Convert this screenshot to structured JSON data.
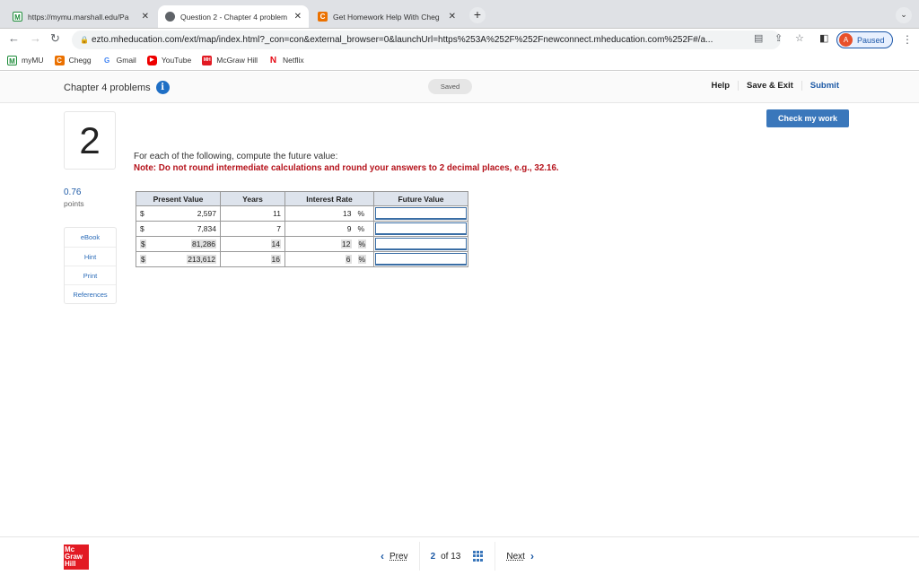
{
  "browser": {
    "tabs": [
      {
        "title": "https://mymu.marshall.edu/Pa",
        "icon": "marshall-m-icon",
        "active": false
      },
      {
        "title": "Question 2 - Chapter 4 problem",
        "icon": "globe-icon",
        "active": true
      },
      {
        "title": "Get Homework Help With Cheg",
        "icon": "chegg-c-icon",
        "active": false
      }
    ],
    "new_tab": "+",
    "tab_menu": "⌄",
    "url": "ezto.mheducation.com/ext/map/index.html?_con=con&external_browser=0&launchUrl=https%253A%252F%252Fnewconnect.mheducation.com%252F#/a...",
    "profile_initial": "A",
    "profile_status": "Paused",
    "bookmarks": [
      {
        "label": "myMU",
        "icon": "marshall-m-icon"
      },
      {
        "label": "Chegg",
        "icon": "chegg-c-icon"
      },
      {
        "label": "Gmail",
        "icon": "google-g-icon"
      },
      {
        "label": "YouTube",
        "icon": "youtube-icon"
      },
      {
        "label": "McGraw Hill",
        "icon": "mcgraw-hill-icon"
      },
      {
        "label": "Netflix",
        "icon": "netflix-icon"
      }
    ]
  },
  "header": {
    "title": "Chapter 4 problems",
    "saved": "Saved",
    "links": {
      "help": "Help",
      "save_exit": "Save & Exit",
      "submit": "Submit"
    }
  },
  "question": {
    "number": "2",
    "points_value": "0.76",
    "points_label": "points",
    "check_button": "Check my work",
    "prompt": "For each of the following, compute the future value:",
    "note": "Note: Do not round intermediate calculations and round your answers to 2 decimal places, e.g., 32.16.",
    "resources": [
      "eBook",
      "Hint",
      "Print",
      "References"
    ]
  },
  "table": {
    "headers": [
      "Present Value",
      "Years",
      "Interest Rate",
      "Future Value"
    ],
    "currency": "$",
    "percent": "%",
    "rows": [
      {
        "pv": "2,597",
        "years": "11",
        "rate": "13",
        "fv": ""
      },
      {
        "pv": "7,834",
        "years": "7",
        "rate": "9",
        "fv": ""
      },
      {
        "pv": "81,286",
        "years": "14",
        "rate": "12",
        "fv": ""
      },
      {
        "pv": "213,612",
        "years": "16",
        "rate": "6",
        "fv": ""
      }
    ]
  },
  "footer": {
    "logo_lines": [
      "Mc",
      "Graw",
      "Hill"
    ],
    "prev": "Prev",
    "current": "2",
    "of_label": "of 13",
    "next": "Next"
  }
}
